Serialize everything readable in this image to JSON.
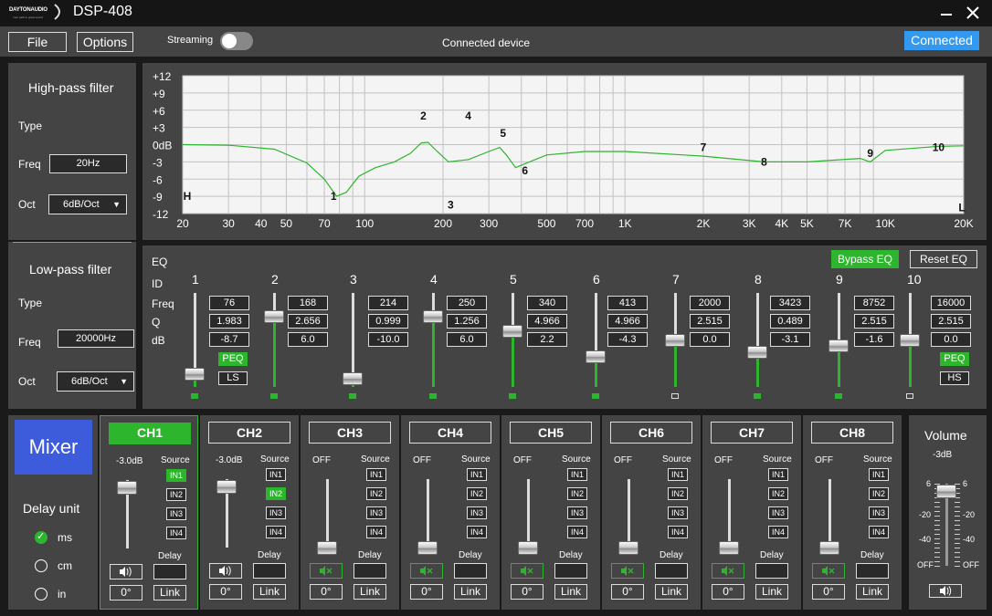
{
  "app": {
    "logo": "DAYTONAUDIO",
    "logo_sub": "Your path to great sound",
    "title": "DSP-408"
  },
  "menu": {
    "file": "File",
    "options": "Options",
    "streaming": "Streaming",
    "center": "Connected device",
    "status": "Connected"
  },
  "hpf": {
    "title": "High-pass filter",
    "type_label": "Type",
    "freq_label": "Freq",
    "freq": "20Hz",
    "oct_label": "Oct",
    "oct": "6dB/Oct"
  },
  "lpf": {
    "title": "Low-pass filter",
    "type_label": "Type",
    "freq_label": "Freq",
    "freq": "20000Hz",
    "oct_label": "Oct",
    "oct": "6dB/Oct"
  },
  "graph": {
    "y_ticks": [
      "+12",
      "+9",
      "+6",
      "+3",
      "0dB",
      "-3",
      "-6",
      "-9",
      "-12"
    ],
    "x_ticks": [
      "20",
      "30",
      "40",
      "50",
      "70",
      "100",
      "200",
      "300",
      "500",
      "700",
      "1K",
      "2K",
      "3K",
      "4K",
      "5K",
      "7K",
      "10K",
      "20K"
    ],
    "markers": [
      "H",
      "1",
      "2",
      "3",
      "4",
      "5",
      "6",
      "7",
      "8",
      "9",
      "10",
      "L"
    ]
  },
  "chart_data": {
    "type": "line",
    "x_scale": "log",
    "xlim": [
      20,
      20000
    ],
    "ylim": [
      -12,
      12
    ],
    "series": [
      {
        "color": "#2db52d",
        "x": [
          20,
          30,
          45,
          60,
          70,
          78,
          85,
          95,
          110,
          130,
          150,
          165,
          175,
          190,
          210,
          250,
          300,
          330,
          350,
          380,
          420,
          500,
          700,
          1000,
          2000,
          3423,
          5000,
          8000,
          8752,
          10000,
          16000,
          20000
        ],
        "y": [
          0,
          -0.1,
          -0.8,
          -3.2,
          -6,
          -9,
          -8.3,
          -5.5,
          -4,
          -3,
          -1.5,
          0.3,
          0.4,
          -1.2,
          -3,
          -2.6,
          -1.2,
          -0.5,
          -1.8,
          -4,
          -3.2,
          -1.8,
          -1.2,
          -1.2,
          -2,
          -3,
          -3,
          -2.4,
          -3,
          -1,
          -0.3,
          -0.2
        ]
      }
    ]
  },
  "eq": {
    "title": "EQ",
    "bypass": "Bypass EQ",
    "reset": "Reset EQ",
    "id_label": "ID",
    "freq_label": "Freq",
    "q_label": "Q",
    "db_label": "dB",
    "bands": [
      {
        "id": "1",
        "freq": "76",
        "q": "1.983",
        "db": "-8.7",
        "gain": -8.7,
        "type1": "PEQ",
        "type2": "LS",
        "active": true
      },
      {
        "id": "2",
        "freq": "168",
        "q": "2.656",
        "db": "6.0",
        "gain": 6.0,
        "active": true
      },
      {
        "id": "3",
        "freq": "214",
        "q": "0.999",
        "db": "-10.0",
        "gain": -10.0,
        "active": true
      },
      {
        "id": "4",
        "freq": "250",
        "q": "1.256",
        "db": "6.0",
        "gain": 6.0,
        "active": true
      },
      {
        "id": "5",
        "freq": "340",
        "q": "4.966",
        "db": "2.2",
        "gain": 2.2,
        "active": true
      },
      {
        "id": "6",
        "freq": "413",
        "q": "4.966",
        "db": "-4.3",
        "gain": -4.3,
        "active": true
      },
      {
        "id": "7",
        "freq": "2000",
        "q": "2.515",
        "db": "0.0",
        "gain": 0.0,
        "active": false
      },
      {
        "id": "8",
        "freq": "3423",
        "q": "0.489",
        "db": "-3.1",
        "gain": -3.1,
        "active": true
      },
      {
        "id": "9",
        "freq": "8752",
        "q": "2.515",
        "db": "-1.6",
        "gain": -1.6,
        "active": true
      },
      {
        "id": "10",
        "freq": "16000",
        "q": "2.515",
        "db": "0.0",
        "gain": 0.0,
        "type1": "PEQ",
        "type2": "HS",
        "active": false
      }
    ]
  },
  "mixer": {
    "label": "Mixer",
    "delay_title": "Delay unit",
    "units": [
      "ms",
      "cm",
      "in"
    ],
    "selected_unit": 0,
    "source_label": "Source",
    "delay_label": "Delay",
    "phase": "0°",
    "link": "Link",
    "inputs": [
      "IN1",
      "IN2",
      "IN3",
      "IN4"
    ],
    "channels": [
      {
        "name": "CH1",
        "level": "-3.0dB",
        "level_pos": 0.9,
        "source": 0,
        "muted": false,
        "selected": true
      },
      {
        "name": "CH2",
        "level": "-3.0dB",
        "level_pos": 0.9,
        "source": 1,
        "muted": false,
        "selected": false
      },
      {
        "name": "CH3",
        "level": "OFF",
        "level_pos": 0,
        "source": -1,
        "muted": true,
        "selected": false
      },
      {
        "name": "CH4",
        "level": "OFF",
        "level_pos": 0,
        "source": -1,
        "muted": true,
        "selected": false
      },
      {
        "name": "CH5",
        "level": "OFF",
        "level_pos": 0,
        "source": -1,
        "muted": true,
        "selected": false
      },
      {
        "name": "CH6",
        "level": "OFF",
        "level_pos": 0,
        "source": -1,
        "muted": true,
        "selected": false
      },
      {
        "name": "CH7",
        "level": "OFF",
        "level_pos": 0,
        "source": -1,
        "muted": true,
        "selected": false
      },
      {
        "name": "CH8",
        "level": "OFF",
        "level_pos": 0,
        "source": -1,
        "muted": true,
        "selected": false
      }
    ]
  },
  "volume": {
    "title": "Volume",
    "value": "-3dB",
    "level_pos": 0.95,
    "ticks": [
      "6",
      "-20",
      "-40",
      "OFF"
    ],
    "ticks_r": [
      "6",
      "-20",
      "-40",
      "OFF"
    ]
  },
  "colors": {
    "green": "#2db52d",
    "blue": "#3399ee",
    "mixer_blue": "#3d5cdc",
    "panel": "#444444"
  }
}
